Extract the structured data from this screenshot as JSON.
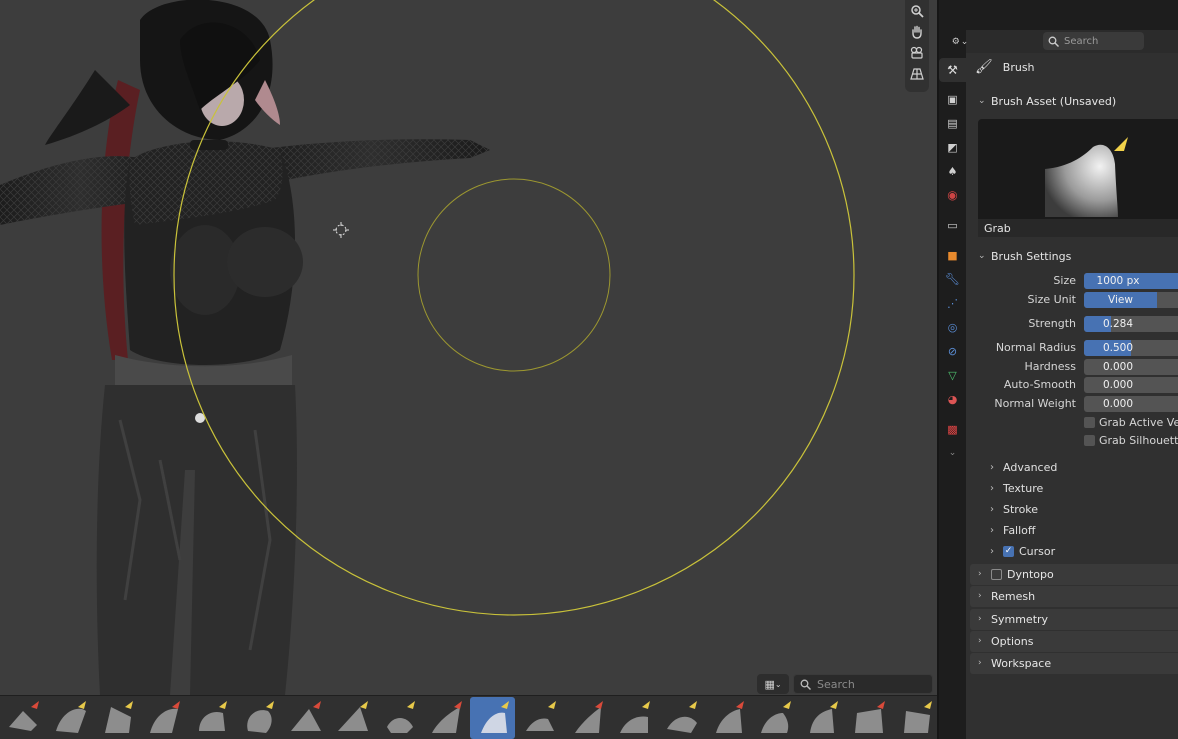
{
  "viewport": {
    "search_placeholder": "Search",
    "nav_icons": [
      "zoom-icon",
      "hand-pan-icon",
      "camera-icon",
      "grid-perspective-icon"
    ],
    "brush_count": 20,
    "active_brush_index": 10
  },
  "properties": {
    "search_placeholder": "Search",
    "context_label": "Brush",
    "brush_asset": {
      "header": "Brush Asset (Unsaved)",
      "name": "Grab"
    },
    "brush_settings": {
      "header": "Brush Settings",
      "size_label": "Size",
      "size_value": "1000 px",
      "size_fill": 1.0,
      "size_unit_label": "Size Unit",
      "size_unit_value": "View",
      "strength_label": "Strength",
      "strength_value": "0.284",
      "strength_fill": 0.284,
      "normal_radius_label": "Normal Radius",
      "normal_radius_value": "0.500",
      "normal_radius_fill": 0.5,
      "hardness_label": "Hardness",
      "hardness_value": "0.000",
      "auto_smooth_label": "Auto-Smooth",
      "auto_smooth_value": "0.000",
      "normal_weight_label": "Normal Weight",
      "normal_weight_value": "0.000",
      "grab_active_vertex_label": "Grab Active Vertex",
      "grab_silhouette_label": "Grab Silhouette"
    },
    "subsections": [
      "Advanced",
      "Texture",
      "Stroke",
      "Falloff"
    ],
    "cursor_label": "Cursor",
    "cursor_checked": true,
    "dyntopo_label": "Dyntopo",
    "sections": [
      "Remesh",
      "Symmetry",
      "Options",
      "Workspace"
    ]
  },
  "colors": {
    "accent": "#4772b3",
    "cursor_circle": "#c9c23a",
    "viewport_bg": "#3d3d3d"
  }
}
